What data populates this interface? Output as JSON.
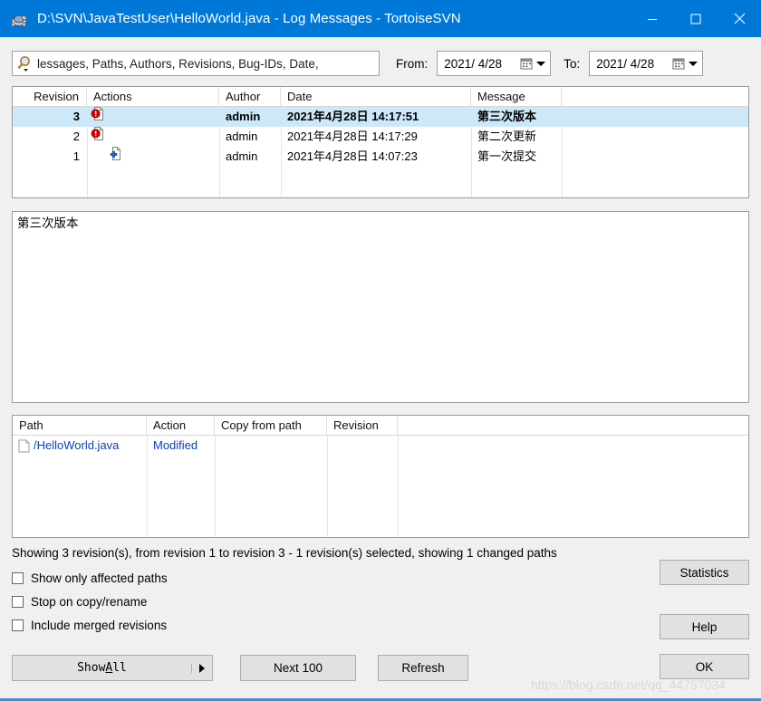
{
  "window": {
    "title": "D:\\SVN\\JavaTestUser\\HelloWorld.java - Log Messages - TortoiseSVN",
    "app_icon": "tortoise-icon",
    "minimize_label": "Minimize",
    "maximize_label": "Maximize",
    "close_label": "Close"
  },
  "filter": {
    "search_icon": "magnifier-icon",
    "search_value": "",
    "search_placeholder": "lessages, Paths, Authors, Revisions, Bug-IDs, Date,",
    "from_label": "From:",
    "from_value": "2021/ 4/28",
    "to_label": "To:",
    "to_value": "2021/ 4/28",
    "calendar_icon": "calendar-icon"
  },
  "revisions": {
    "columns": [
      "Revision",
      "Actions",
      "Author",
      "Date",
      "Message"
    ],
    "rows": [
      {
        "revision": "3",
        "action_icon": "modified-file-icon",
        "author": "admin",
        "date": "2021年4月28日 14:17:51",
        "message": "第三次版本",
        "selected": true
      },
      {
        "revision": "2",
        "action_icon": "modified-file-icon",
        "author": "admin",
        "date": "2021年4月28日 14:17:29",
        "message": "第二次更新",
        "selected": false
      },
      {
        "revision": "1",
        "action_icon": "added-file-icon",
        "author": "admin",
        "date": "2021年4月28日 14:07:23",
        "message": "第一次提交",
        "selected": false
      }
    ]
  },
  "message_pane": {
    "text": "第三次版本"
  },
  "paths": {
    "columns": [
      "Path",
      "Action",
      "Copy from path",
      "Revision"
    ],
    "rows": [
      {
        "icon": "file-icon",
        "path": "/HelloWorld.java",
        "action": "Modified",
        "copy_from_path": "",
        "revision": ""
      }
    ]
  },
  "status": {
    "text": "Showing 3 revision(s), from revision 1 to revision 3 - 1 revision(s) selected, showing 1 changed paths"
  },
  "options": [
    {
      "label": "Show only affected paths",
      "checked": false
    },
    {
      "label": "Stop on copy/rename",
      "checked": false
    },
    {
      "label": "Include merged revisions",
      "checked": false
    }
  ],
  "buttons": {
    "show_all_prefix": "Show ",
    "show_all_accel": "A",
    "show_all_suffix": "ll",
    "next_100": "Next 100",
    "refresh": "Refresh",
    "statistics": "Statistics",
    "help": "Help",
    "ok": "OK"
  },
  "watermark": {
    "text": "https://blog.csdn.net/qq_44757034"
  },
  "colors": {
    "titlebar": "#0078d7",
    "selection": "#cde8f9",
    "link": "#0b3fb5",
    "dialog_bg": "#f0f0f0",
    "modified_badge": "#cc0000",
    "added_badge": "#1f6fd0"
  }
}
